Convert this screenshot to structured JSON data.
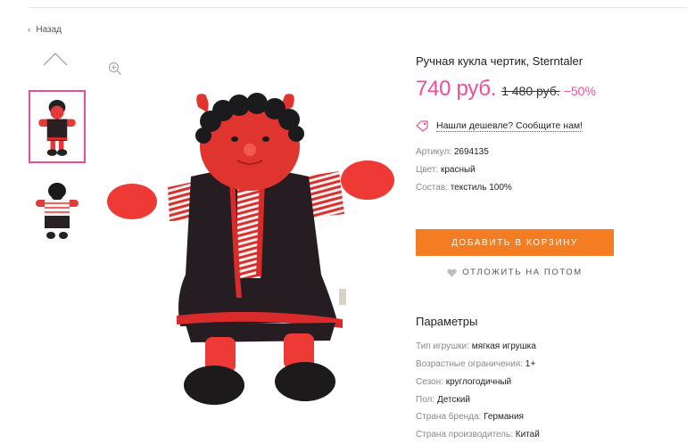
{
  "nav": {
    "back_label": "Назад"
  },
  "product": {
    "title": "Ручная кукла чертик, Sterntaler",
    "price": "740 руб.",
    "old_price": "1 480 руб.",
    "discount": "−50%",
    "cheaper_link": "Нашли дешевле? Сообщите нам!",
    "attributes": [
      {
        "label": "Артикул:",
        "value": "2694135"
      },
      {
        "label": "Цвет:",
        "value": "красный"
      },
      {
        "label": "Состав:",
        "value": "текстиль 100%"
      }
    ],
    "add_to_cart_label": "ДОБАВИТЬ В КОРЗИНУ",
    "save_later_label": "ОТЛОЖИТЬ НА ПОТОМ"
  },
  "params": {
    "title": "Параметры",
    "items": [
      {
        "label": "Тип игрушки:",
        "value": "мягкая игрушка"
      },
      {
        "label": "Возрастные ограничения:",
        "value": "1+"
      },
      {
        "label": "Сезон:",
        "value": "круглогодичный"
      },
      {
        "label": "Пол:",
        "value": "Детский"
      },
      {
        "label": "Страна бренда:",
        "value": "Германия"
      },
      {
        "label": "Страна производитель:",
        "value": "Китай"
      }
    ]
  },
  "colors": {
    "accent_pink": "#ec4f9a",
    "cart_orange": "#f47d24"
  },
  "icons": [
    "chevron-left-icon",
    "chevron-up-icon",
    "zoom-in-icon",
    "price-tag-icon",
    "heart-icon"
  ]
}
